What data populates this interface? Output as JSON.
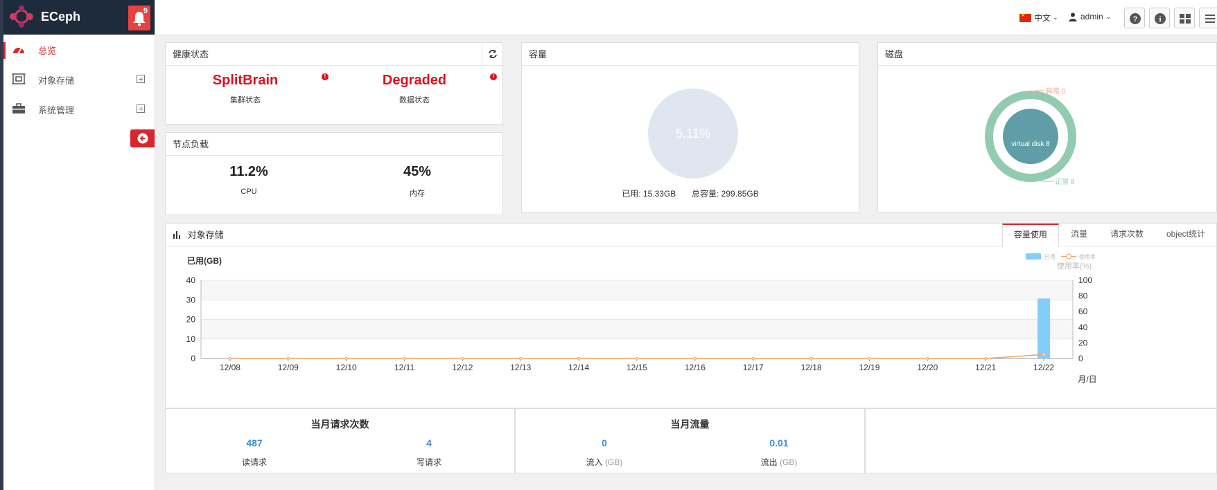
{
  "app": {
    "name": "ECeph",
    "notification_count": "9"
  },
  "sidebar": {
    "items": [
      {
        "label": "总览",
        "active": true
      },
      {
        "label": "对象存储",
        "expandable": true
      },
      {
        "label": "系统管理",
        "expandable": true
      }
    ]
  },
  "topbar": {
    "language": "中文",
    "user": "admin"
  },
  "health": {
    "title": "健康状态",
    "cluster_status": "SplitBrain",
    "cluster_label": "集群状态",
    "data_status": "Degraded",
    "data_label": "数据状态"
  },
  "load": {
    "title": "节点负载",
    "cpu_value": "11.2%",
    "cpu_label": "CPU",
    "mem_value": "45%",
    "mem_label": "内存"
  },
  "capacity": {
    "title": "容量",
    "percent": "5.11%",
    "used_text": "已用: 15.33GB",
    "total_text": "总容量: 299.85GB"
  },
  "disk": {
    "title": "磁盘",
    "center_label": "virtual disk 8",
    "abnormal_label": "异常 0",
    "normal_label": "正常 8"
  },
  "object_storage": {
    "title": "对象存储",
    "tabs": [
      "容量使用",
      "流量",
      "请求次数",
      "object统计"
    ],
    "active_tab": 0
  },
  "chart_data": {
    "type": "bar",
    "ylabel": "已用(GB)",
    "y2label": "使用率(%)",
    "xlabel": "月/日",
    "categories": [
      "12/08",
      "12/09",
      "12/10",
      "12/11",
      "12/12",
      "12/13",
      "12/14",
      "12/15",
      "12/16",
      "12/17",
      "12/18",
      "12/19",
      "12/20",
      "12/21",
      "12/22"
    ],
    "series": [
      {
        "name": "已用",
        "type": "bar",
        "axis": "left",
        "color": "#82cdfb",
        "values": [
          0,
          0,
          0,
          0,
          0,
          0,
          0,
          0,
          0,
          0,
          0,
          0,
          0,
          0,
          30.7
        ]
      },
      {
        "name": "使用率",
        "type": "line",
        "axis": "right",
        "color": "#f4a261",
        "values": [
          0,
          0,
          0,
          0,
          0,
          0,
          0,
          0,
          0,
          0,
          0,
          0,
          0,
          0,
          5.11
        ]
      }
    ],
    "ylim": [
      0,
      40
    ],
    "yticks": [
      0,
      10,
      20,
      30,
      40
    ],
    "y2lim": [
      0,
      100
    ],
    "y2ticks": [
      0,
      20,
      40,
      60,
      80,
      100
    ],
    "legend_position": "top-right"
  },
  "monthly_requests": {
    "title": "当月请求次数",
    "read_value": "487",
    "read_label": "读请求",
    "write_value": "4",
    "write_label": "写请求"
  },
  "monthly_traffic": {
    "title": "当月流量",
    "in_value": "0",
    "in_label": "流入",
    "in_unit": "(GB)",
    "out_value": "0.01",
    "out_label": "流出",
    "out_unit": "(GB)"
  }
}
